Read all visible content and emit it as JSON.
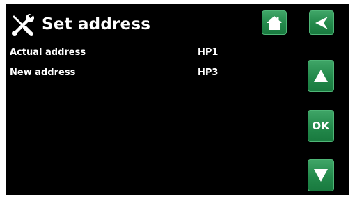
{
  "header": {
    "title": "Set address",
    "icon": "tools-icon"
  },
  "rows": [
    {
      "label": "Actual address",
      "value": "HP1"
    },
    {
      "label": "New address",
      "value": "HP3"
    }
  ],
  "buttons": {
    "home": {
      "icon": "home-icon"
    },
    "back": {
      "icon": "back-arrow-icon"
    },
    "up": {
      "icon": "arrow-up-icon"
    },
    "ok": {
      "label": "OK"
    },
    "down": {
      "icon": "arrow-down-icon"
    }
  },
  "colors": {
    "background": "#000000",
    "text": "#ffffff",
    "button": "#23894b"
  }
}
